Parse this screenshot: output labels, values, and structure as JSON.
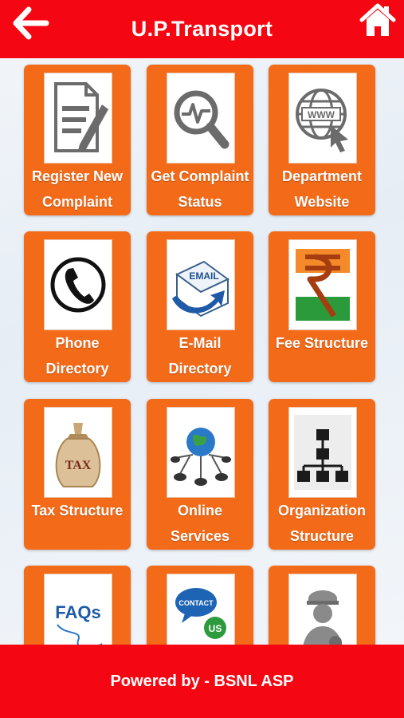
{
  "header": {
    "title": "U.P.Transport"
  },
  "tiles": [
    {
      "label_line1": "Register New",
      "label_line2": "Complaint",
      "icon": "document-pen-icon"
    },
    {
      "label_line1": "Get Complaint",
      "label_line2": "Status",
      "icon": "magnifier-pulse-icon"
    },
    {
      "label_line1": "Department",
      "label_line2": "Website",
      "icon": "globe-www-icon"
    },
    {
      "label_line1": "Phone",
      "label_line2": "Directory",
      "icon": "telephone-icon"
    },
    {
      "label_line1": "E-Mail",
      "label_line2": "Directory",
      "icon": "email-envelope-icon",
      "icon_text": "EMAIL"
    },
    {
      "label_line1": "Fee Structure",
      "label_line2": "",
      "icon": "rupee-icon"
    },
    {
      "label_line1": "Tax Structure",
      "label_line2": "",
      "icon": "tax-bag-icon",
      "icon_text": "TAX"
    },
    {
      "label_line1": "Online",
      "label_line2": "Services",
      "icon": "globe-network-icon"
    },
    {
      "label_line1": "Organization",
      "label_line2": "Structure",
      "icon": "org-chart-icon"
    },
    {
      "label_line1": "",
      "label_line2": "",
      "icon": "faq-icon",
      "icon_text": "FAQs"
    },
    {
      "label_line1": "",
      "label_line2": "",
      "icon": "contact-us-icon",
      "icon_text": "CONTACT",
      "icon_text2": "US"
    },
    {
      "label_line1": "",
      "label_line2": "",
      "icon": "police-officer-icon"
    }
  ],
  "footer": {
    "text": "Powered by - BSNL ASP"
  },
  "colors": {
    "header_red": "#f40712",
    "tile_orange": "#f36a18"
  }
}
